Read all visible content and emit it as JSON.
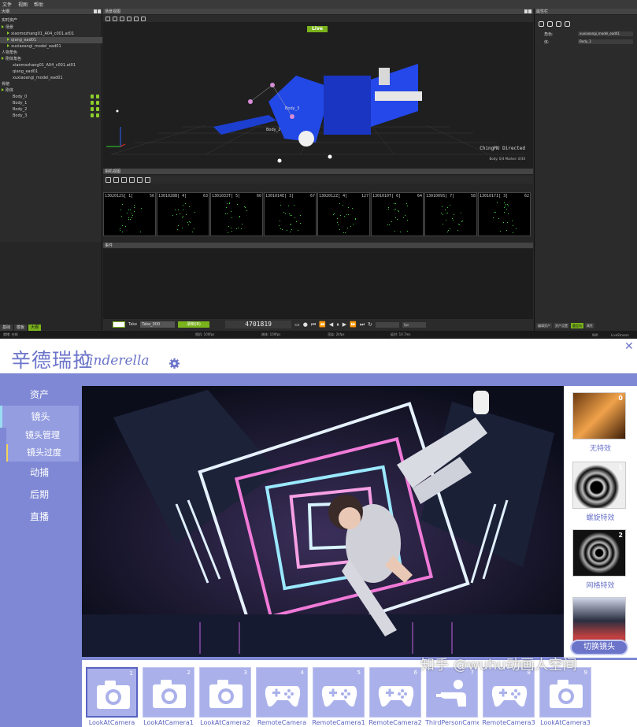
{
  "top_app": {
    "menu": [
      "文件",
      "视图",
      "帮助"
    ],
    "outliner": {
      "title": "大纲",
      "section_title": "实时资产",
      "rows": [
        {
          "label": "场景",
          "indent": 0,
          "tri": true
        },
        {
          "label": "xiaomozhang01_A04_c001.at01",
          "indent": 1,
          "tri": true
        },
        {
          "label": "qiang_ead01",
          "indent": 1,
          "tri": true,
          "selected": true
        },
        {
          "label": "xuxiaoangi_model_ead01",
          "indent": 1,
          "tri": true
        },
        {
          "label": "人物角色",
          "indent": 0
        },
        {
          "label": "刚体角色",
          "indent": 0,
          "tri": true
        },
        {
          "label": "xiaomozhang01_A04_c001.at01",
          "indent": 2
        },
        {
          "label": "qiang_ead01",
          "indent": 2
        },
        {
          "label": "xuxiaoangi_model_ead01",
          "indent": 2
        },
        {
          "label": "骨骼",
          "indent": 0
        },
        {
          "label": "刚体",
          "indent": 0,
          "tri": true
        },
        {
          "label": "Body_0",
          "indent": 2,
          "icons": true
        },
        {
          "label": "Body_1",
          "indent": 2,
          "icons": true
        },
        {
          "label": "Body_2",
          "indent": 2,
          "icons": true
        },
        {
          "label": "Body_3",
          "indent": 2,
          "icons": true
        }
      ],
      "tabs": [
        "基础",
        "模板",
        "大纲"
      ]
    },
    "viewport": {
      "title": "场景视图",
      "live_label": "Live",
      "watermark": "ChingMU Directed",
      "status": "Body: 0/4  Marker: 0/30",
      "body_labels": [
        "Body_3",
        "Body_2"
      ]
    },
    "camera_view": {
      "title": "相机视图",
      "cameras": [
        {
          "id": "1302012S[ 1]",
          "val": "56"
        },
        {
          "id": "1301028B[ 4]",
          "val": "63"
        },
        {
          "id": "1301033T[ 5]",
          "val": "60"
        },
        {
          "id": "1301014E[ 3]",
          "val": "67"
        },
        {
          "id": "1302012Z[ 4]",
          "val": "127"
        },
        {
          "id": "1301010T[ 6]",
          "val": "64"
        },
        {
          "id": "1301009S[ 7]",
          "val": "58"
        },
        {
          "id": "1301017I[ 3]",
          "val": "62"
        }
      ]
    },
    "timeline": {
      "title": "事件",
      "take_label": "Take",
      "take_name": "Take_000",
      "record_label": "录制(R)",
      "frame_count": "4701819",
      "fps_label": "fps"
    },
    "properties": {
      "title": "属性栏",
      "role_label": "角色:",
      "role_value": "xuxiaoangi_model_ead01",
      "body_label": "体:",
      "body_value": "Body_3",
      "tabs": [
        "编辑资产",
        "资产设置",
        "重定向",
        "属性"
      ]
    },
    "statusbar": {
      "ready": "就绪: 在线",
      "camera_fps": "相机: 100fps",
      "rigid_fps": "刚体: 100fps",
      "render_fps": "渲染: 2kfps",
      "latency": "延时: 10.7ms",
      "wifi": "Wifi",
      "livestream": "LiveStream"
    }
  },
  "bottom_app": {
    "brand_cn": "辛德瑞拉",
    "brand_en": "Cinderella",
    "nav": [
      {
        "label": "资产"
      },
      {
        "label": "镜头",
        "active": true
      },
      {
        "label": "动捕"
      },
      {
        "label": "后期"
      },
      {
        "label": "直播"
      }
    ],
    "subnav": [
      "镜头管理",
      "镜头过度"
    ],
    "effects": [
      {
        "num": "0",
        "label": "无特效"
      },
      {
        "num": "1",
        "label": "螺旋特效"
      },
      {
        "num": "2",
        "label": "网格特效"
      },
      {
        "num": "",
        "label": ""
      }
    ],
    "switch_label": "切换镜头",
    "cameras": [
      {
        "num": "1",
        "name": "LookAtCamera",
        "icon": "camera",
        "selected": true
      },
      {
        "num": "2",
        "name": "LookAtCamera1",
        "icon": "camera"
      },
      {
        "num": "3",
        "name": "LookAtCamera2",
        "icon": "camera"
      },
      {
        "num": "4",
        "name": "RemoteCamera",
        "icon": "gamepad"
      },
      {
        "num": "5",
        "name": "RemoteCamera1",
        "icon": "gamepad"
      },
      {
        "num": "6",
        "name": "RemoteCamera2",
        "icon": "gamepad"
      },
      {
        "num": "7",
        "name": "ThirdPersonCamera",
        "icon": "person"
      },
      {
        "num": "8",
        "name": "RemoteCamera3",
        "icon": "gamepad"
      },
      {
        "num": "9",
        "name": "LookAtCamera3",
        "icon": "camera"
      }
    ],
    "watermark": "知乎 @wuhu动画人空间",
    "colors": {
      "accent": "#6b74c9",
      "panel": "#7e88d4",
      "card": "#aab1ea",
      "live": "#7ab31c"
    }
  }
}
